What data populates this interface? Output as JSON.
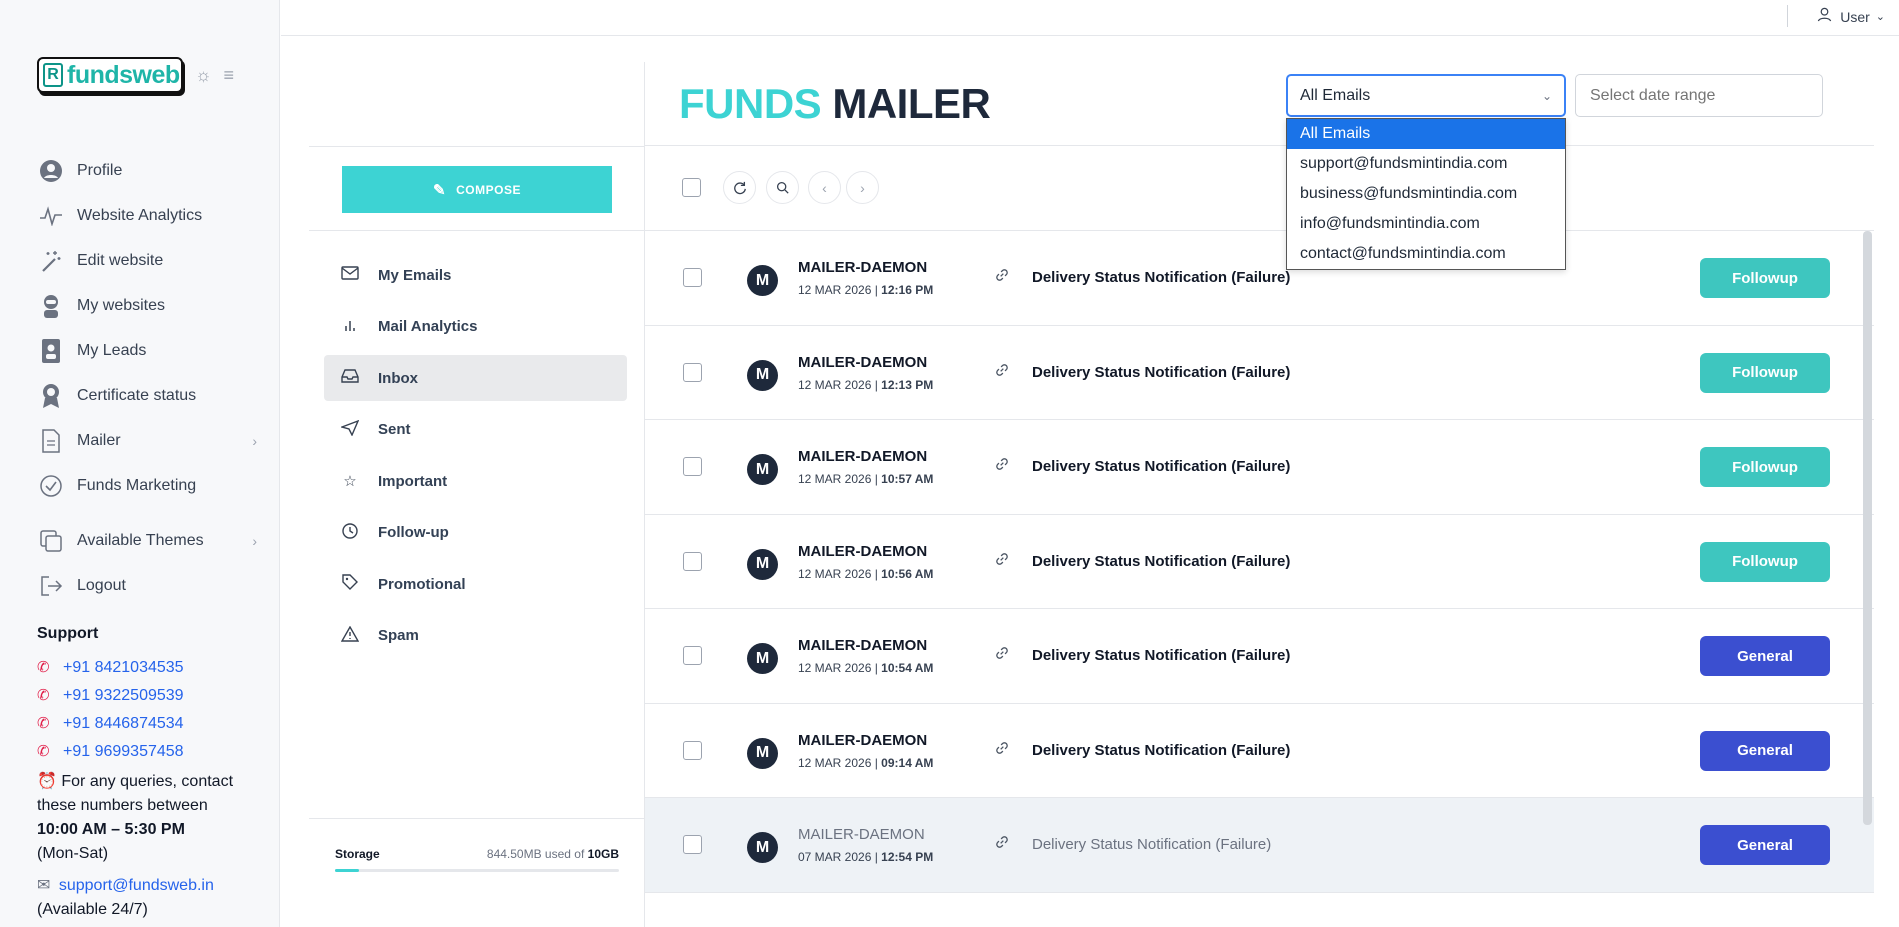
{
  "sidebar": {
    "logo_text": "fundsweb",
    "logo_mark": "R",
    "items": [
      {
        "label": "Profile",
        "icon": "user-circle-icon"
      },
      {
        "label": "Website Analytics",
        "icon": "activity-icon"
      },
      {
        "label": "Edit website",
        "icon": "magic-wand-icon"
      },
      {
        "label": "My websites",
        "icon": "robot-icon"
      },
      {
        "label": "My Leads",
        "icon": "id-badge-icon"
      },
      {
        "label": "Certificate status",
        "icon": "award-icon"
      },
      {
        "label": "Mailer",
        "icon": "file-icon"
      },
      {
        "label": "Funds Marketing",
        "icon": "check-circle-icon"
      },
      {
        "label": "Available Themes",
        "icon": "copy-icon"
      },
      {
        "label": "Logout",
        "icon": "logout-icon"
      }
    ],
    "support": {
      "heading": "Support",
      "phones": [
        "+91 8421034535",
        "+91 9322509539",
        "+91 8446874534",
        "+91 9699357458"
      ],
      "note_prefix": "For any queries, contact these numbers between",
      "hours": "10:00 AM – 5:30 PM",
      "days": "(Mon-Sat)",
      "email": "support@fundsweb.in",
      "email_note": "(Available 24/7)"
    }
  },
  "topbar": {
    "user_label": "User"
  },
  "mailer": {
    "title_part1": "FUNDS",
    "title_part2": "MAILER",
    "compose_label": "COMPOSE",
    "folders": [
      {
        "label": "My Emails",
        "icon": "mail-icon"
      },
      {
        "label": "Mail Analytics",
        "icon": "bar-chart-icon"
      },
      {
        "label": "Inbox",
        "icon": "inbox-icon"
      },
      {
        "label": "Sent",
        "icon": "send-icon"
      },
      {
        "label": "Important",
        "icon": "star-icon"
      },
      {
        "label": "Follow-up",
        "icon": "clock-icon"
      },
      {
        "label": "Promotional",
        "icon": "tag-icon"
      },
      {
        "label": "Spam",
        "icon": "warning-icon"
      }
    ],
    "active_folder": "Inbox",
    "storage": {
      "label": "Storage",
      "used": "844.50MB used of",
      "total": "10GB",
      "fraction": 0.0845
    },
    "filter": {
      "selected": "All Emails",
      "options": [
        "All Emails",
        "support@fundsmintindia.com",
        "business@fundsmintindia.com",
        "info@fundsmintindia.com",
        "contact@fundsmintindia.com"
      ]
    },
    "date_placeholder": "Select date range",
    "emails": [
      {
        "avatar": "M",
        "sender": "MAILER-DAEMON",
        "date": "12 MAR 2026 |",
        "time": "12:16 PM",
        "subject": "Delivery Status Notification (Failure)",
        "tag": "Followup",
        "tag_color": "#3ec6bf",
        "read": false
      },
      {
        "avatar": "M",
        "sender": "MAILER-DAEMON",
        "date": "12 MAR 2026 |",
        "time": "12:13 PM",
        "subject": "Delivery Status Notification (Failure)",
        "tag": "Followup",
        "tag_color": "#3ec6bf",
        "read": false
      },
      {
        "avatar": "M",
        "sender": "MAILER-DAEMON",
        "date": "12 MAR 2026 |",
        "time": "10:57 AM",
        "subject": "Delivery Status Notification (Failure)",
        "tag": "Followup",
        "tag_color": "#3ec6bf",
        "read": false
      },
      {
        "avatar": "M",
        "sender": "MAILER-DAEMON",
        "date": "12 MAR 2026 |",
        "time": "10:56 AM",
        "subject": "Delivery Status Notification (Failure)",
        "tag": "Followup",
        "tag_color": "#3ec6bf",
        "read": false
      },
      {
        "avatar": "M",
        "sender": "MAILER-DAEMON",
        "date": "12 MAR 2026 |",
        "time": "10:54 AM",
        "subject": "Delivery Status Notification (Failure)",
        "tag": "General",
        "tag_color": "#3b4fd0",
        "read": false
      },
      {
        "avatar": "M",
        "sender": "MAILER-DAEMON",
        "date": "12 MAR 2026 |",
        "time": "09:14 AM",
        "subject": "Delivery Status Notification (Failure)",
        "tag": "General",
        "tag_color": "#3b4fd0",
        "read": false
      },
      {
        "avatar": "M",
        "sender": "MAILER-DAEMON",
        "date": "07 MAR 2026 |",
        "time": "12:54 PM",
        "subject": "Delivery Status Notification (Failure)",
        "tag": "General",
        "tag_color": "#3b4fd0",
        "read": true
      }
    ]
  }
}
